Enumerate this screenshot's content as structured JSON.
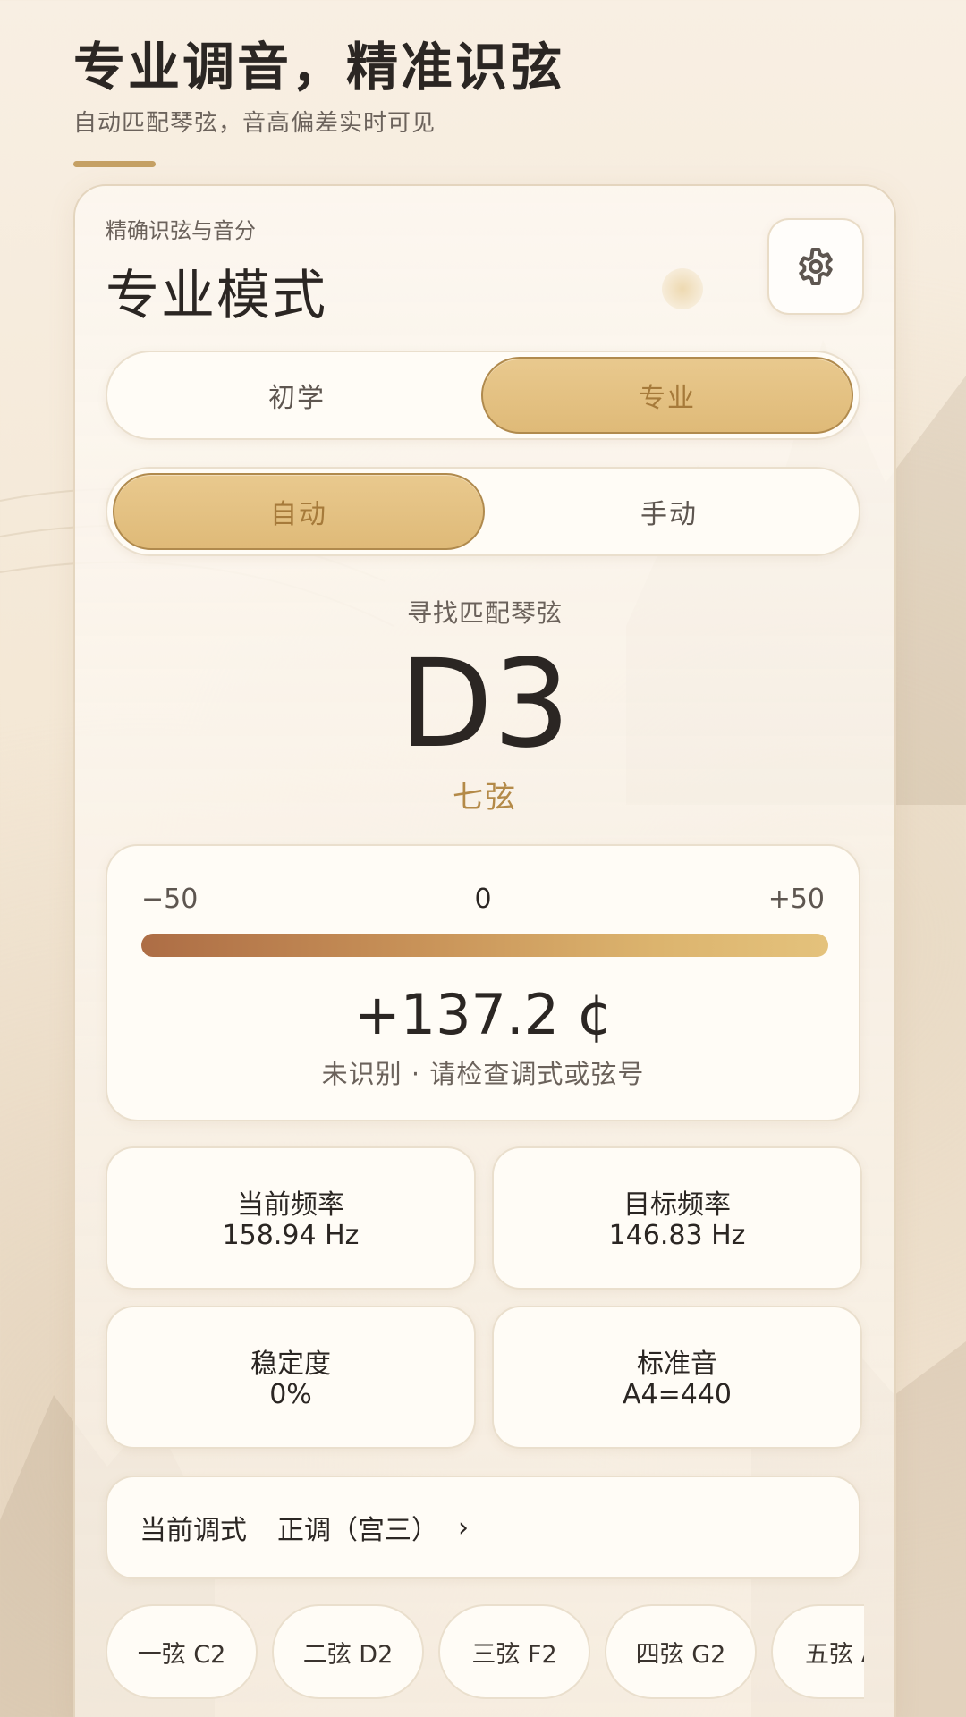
{
  "header": {
    "title": "专业调音，精准识弦",
    "subtitle": "自动匹配琴弦，音高偏差实时可见"
  },
  "mode": {
    "small_label": "精确识弦与音分",
    "title": "专业模式",
    "settings_icon": "gear-icon"
  },
  "level_toggle": {
    "options": [
      "初学",
      "专业"
    ],
    "selected": "专业"
  },
  "detect_toggle": {
    "options": [
      "自动",
      "手动"
    ],
    "selected": "自动"
  },
  "detection": {
    "seek_label": "寻找匹配琴弦",
    "note": "D3",
    "string": "七弦"
  },
  "meter": {
    "min_label": "−50",
    "mid_label": "0",
    "max_label": "+50",
    "cents": "+137.2 ¢",
    "status": "未识别 · 请检查调式或弦号"
  },
  "stats": {
    "current_freq": {
      "label": "当前频率",
      "value": "158.94 Hz"
    },
    "target_freq": {
      "label": "目标频率",
      "value": "146.83 Hz"
    },
    "stability": {
      "label": "稳定度",
      "value": "0%"
    },
    "reference": {
      "label": "标准音",
      "value": "A4=440"
    }
  },
  "tuning": {
    "label": "当前调式",
    "value": "正调（宫三）",
    "chevron": "›"
  },
  "strings": [
    {
      "label": "一弦 C2"
    },
    {
      "label": "二弦 D2"
    },
    {
      "label": "三弦 F2"
    },
    {
      "label": "四弦 G2"
    },
    {
      "label": "五弦 A"
    }
  ],
  "colors": {
    "accent": "#dfba78",
    "accent_text": "#a67a3a",
    "string_name": "#b48a48",
    "meter_start": "#ad6d45",
    "meter_end": "#e4c27c"
  }
}
